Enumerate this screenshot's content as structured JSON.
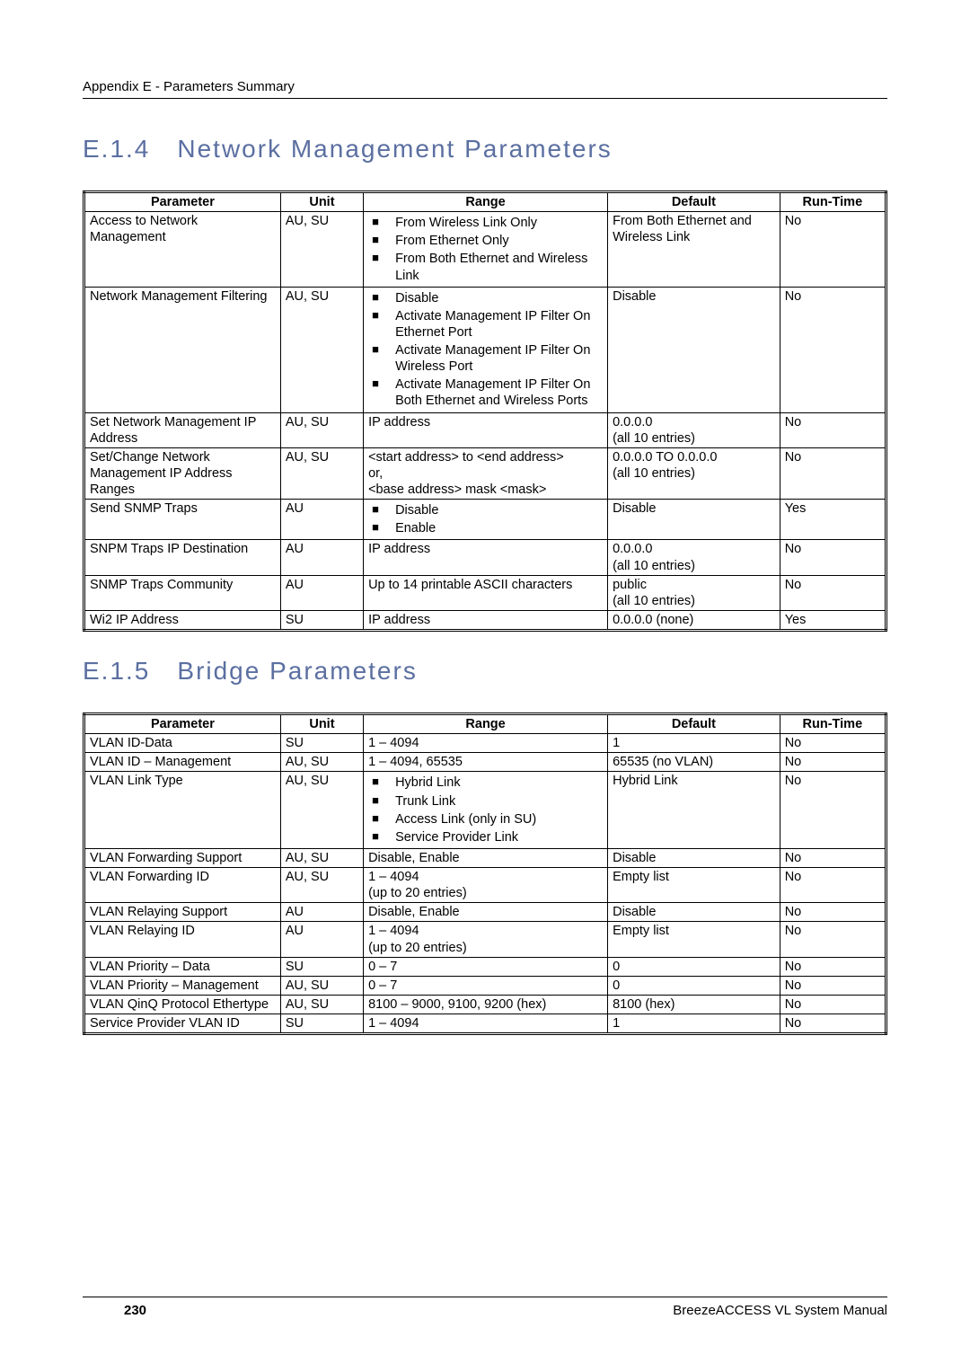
{
  "header": {
    "text": "Appendix E - Parameters Summary"
  },
  "section1": {
    "num": "E.1.4",
    "title": "Network Management Parameters"
  },
  "section2": {
    "num": "E.1.5",
    "title": "Bridge Parameters"
  },
  "columns": [
    "Parameter",
    "Unit",
    "Range",
    "Default",
    "Run-Time"
  ],
  "table1": [
    {
      "param": "Access to Network Management",
      "unit": "AU, SU",
      "range_bullets": [
        "From Wireless Link Only",
        "From Ethernet Only",
        "From Both Ethernet and Wireless Link"
      ],
      "default": "From Both Ethernet and Wireless Link",
      "runtime": "No"
    },
    {
      "param": "Network Management Filtering",
      "unit": "AU, SU",
      "range_bullets": [
        "Disable",
        "Activate Management IP Filter On Ethernet Port",
        "Activate Management IP Filter On Wireless Port",
        "Activate Management IP Filter On Both Ethernet and Wireless Ports"
      ],
      "default": "Disable",
      "runtime": "No"
    },
    {
      "param": "Set Network Management IP Address",
      "unit": "AU, SU",
      "range_text": "IP address",
      "default": "0.0.0.0\n(all 10 entries)",
      "runtime": "No"
    },
    {
      "param": "Set/Change Network Management IP Address Ranges",
      "unit": "AU, SU",
      "range_text": "<start address> to <end address>\nor,\n<base address> mask <mask>",
      "default": "0.0.0.0 TO 0.0.0.0\n(all 10 entries)",
      "runtime": "No"
    },
    {
      "param": "Send SNMP Traps",
      "unit": "AU",
      "range_bullets": [
        "Disable",
        "Enable"
      ],
      "default": "Disable",
      "runtime": "Yes"
    },
    {
      "param": "SNPM Traps IP Destination",
      "unit": "AU",
      "range_text": "IP address",
      "default": "0.0.0.0\n(all 10 entries)",
      "runtime": "No"
    },
    {
      "param": "SNMP Traps Community",
      "unit": "AU",
      "range_text": "Up to 14 printable ASCII characters",
      "default": "public\n(all 10 entries)",
      "runtime": "No"
    },
    {
      "param": "Wi2 IP Address",
      "unit": "SU",
      "range_text": "IP address",
      "default": "0.0.0.0 (none)",
      "runtime": "Yes"
    }
  ],
  "table2": [
    {
      "param": "VLAN ID-Data",
      "unit": "SU",
      "range_text": "1 – 4094",
      "default": "1",
      "runtime": "No"
    },
    {
      "param": "VLAN ID – Management",
      "unit": "AU, SU",
      "range_text": "1 – 4094, 65535",
      "default": "65535 (no VLAN)",
      "runtime": "No"
    },
    {
      "param": "VLAN Link Type",
      "unit": "AU, SU",
      "range_bullets": [
        "Hybrid Link",
        "Trunk Link",
        "Access Link (only in SU)",
        "Service Provider Link"
      ],
      "default": "Hybrid Link",
      "runtime": "No"
    },
    {
      "param": "VLAN Forwarding Support",
      "unit": "AU, SU",
      "range_text": "Disable, Enable",
      "default": "Disable",
      "runtime": "No"
    },
    {
      "param": "VLAN Forwarding ID",
      "unit": "AU, SU",
      "range_text": "1 – 4094\n(up to 20 entries)",
      "default": "Empty list",
      "runtime": "No"
    },
    {
      "param": "VLAN Relaying Support",
      "unit": "AU",
      "range_text": "Disable, Enable",
      "default": "Disable",
      "runtime": "No"
    },
    {
      "param": "VLAN Relaying ID",
      "unit": "AU",
      "range_text": "1 – 4094\n(up to 20 entries)",
      "default": "Empty list",
      "runtime": "No"
    },
    {
      "param": "VLAN Priority – Data",
      "unit": "SU",
      "range_text": "0 – 7",
      "default": "0",
      "runtime": "No"
    },
    {
      "param": "VLAN Priority – Management",
      "unit": "AU, SU",
      "range_text": "0 – 7",
      "default": "0",
      "runtime": "No"
    },
    {
      "param": "VLAN QinQ Protocol Ethertype",
      "unit": "AU, SU",
      "range_text": "8100 – 9000, 9100, 9200 (hex)",
      "default": "8100 (hex)",
      "runtime": "No"
    },
    {
      "param": "Service Provider VLAN ID",
      "unit": "SU",
      "range_text": "1 – 4094",
      "default": "1",
      "runtime": "No"
    }
  ],
  "footer": {
    "page": "230",
    "manual": "BreezeACCESS VL System Manual"
  }
}
